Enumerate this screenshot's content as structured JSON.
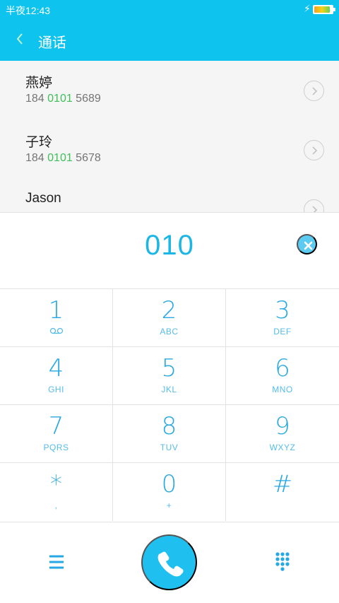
{
  "status_bar": {
    "time": "半夜12:43",
    "battery_level": 0.85
  },
  "header": {
    "title": "通话"
  },
  "search_results": [
    {
      "name": "燕婷",
      "number_prefix": "184 ",
      "number_match": "0101",
      "number_suffix": " 5689"
    },
    {
      "name": "子玲",
      "number_prefix": "184 ",
      "number_match": "0101",
      "number_suffix": " 5678"
    },
    {
      "name": "Jason",
      "number_prefix": "",
      "number_match": "",
      "number_suffix": ""
    }
  ],
  "dialer": {
    "entered_digits": "010"
  },
  "keypad": {
    "keys": [
      {
        "digit": "1",
        "letters": ""
      },
      {
        "digit": "2",
        "letters": "ABC"
      },
      {
        "digit": "3",
        "letters": "DEF"
      },
      {
        "digit": "4",
        "letters": "GHI"
      },
      {
        "digit": "5",
        "letters": "JKL"
      },
      {
        "digit": "6",
        "letters": "MNO"
      },
      {
        "digit": "7",
        "letters": "PQRS"
      },
      {
        "digit": "8",
        "letters": "TUV"
      },
      {
        "digit": "9",
        "letters": "WXYZ"
      },
      {
        "digit": "*",
        "letters": ","
      },
      {
        "digit": "0",
        "letters": "+"
      },
      {
        "digit": "#",
        "letters": ""
      }
    ]
  },
  "icons": {
    "back": "chevron-left-icon",
    "voicemail": "voicemail-icon",
    "clear": "clear-circle-icon",
    "menu": "menu-icon",
    "call": "phone-icon",
    "keypad_toggle": "dialpad-icon"
  },
  "colors": {
    "accent": "#0ec3ee",
    "match_highlight": "#3fbe59",
    "key_text": "#27a8e2"
  }
}
